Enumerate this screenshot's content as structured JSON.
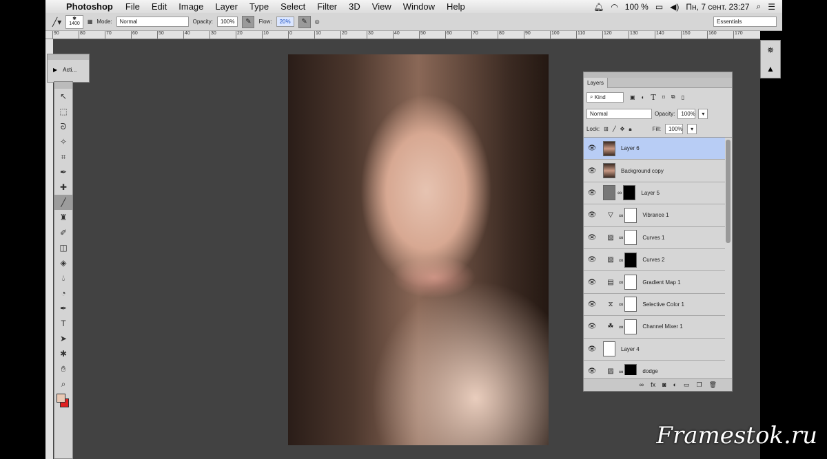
{
  "menubar": {
    "apple_icon": "apple-icon",
    "app": "Photoshop",
    "items": [
      "File",
      "Edit",
      "Image",
      "Layer",
      "Type",
      "Select",
      "Filter",
      "3D",
      "View",
      "Window",
      "Help"
    ],
    "battery": "100 %",
    "datetime": "Пн, 7 сент. 23:27"
  },
  "options": {
    "brush_size": "1400",
    "mode_label": "Mode:",
    "mode": "Normal",
    "opacity_label": "Opacity:",
    "opacity": "100%",
    "flow_label": "Flow:",
    "flow": "20%",
    "workspace": "Essentials"
  },
  "ruler": [
    "90",
    "80",
    "70",
    "60",
    "50",
    "40",
    "30",
    "20",
    "10",
    "0",
    "10",
    "20",
    "30",
    "40",
    "50",
    "60",
    "70",
    "80",
    "90",
    "100",
    "110",
    "120",
    "130",
    "140",
    "150",
    "160",
    "170"
  ],
  "actions_panel": {
    "label": "Acti..."
  },
  "layers_panel": {
    "tab": "Layers",
    "filter": "Kind",
    "blend": "Normal",
    "opacity_label": "Opacity:",
    "opacity": "100%",
    "lock_label": "Lock:",
    "fill_label": "Fill:",
    "fill": "100%",
    "layers": [
      {
        "name": "Layer 6",
        "selected": true,
        "thumb": "photo"
      },
      {
        "name": "Background copy",
        "thumb": "photo"
      },
      {
        "name": "Layer 5",
        "thumb": "gray",
        "mask": "black"
      },
      {
        "name": "Vibrance 1",
        "icon": "▽",
        "mask": "white"
      },
      {
        "name": "Curves 1",
        "icon": "▨",
        "mask": "white"
      },
      {
        "name": "Curves 2",
        "icon": "▨",
        "mask": "black"
      },
      {
        "name": "Gradient Map 1",
        "icon": "▤",
        "mask": "white"
      },
      {
        "name": "Selective Color 1",
        "icon": "⧖",
        "mask": "white"
      },
      {
        "name": "Channel Mixer 1",
        "icon": "☘",
        "mask": "white"
      },
      {
        "name": "Layer 4",
        "thumb": "white"
      },
      {
        "name": "dodge",
        "icon": "▨",
        "mask": "black"
      }
    ]
  },
  "watermark": "Framestok.ru",
  "colors": {
    "selection": "#b8cdf5",
    "canvas_bg": "#424242",
    "foreground": "#e8c8b4",
    "background": "#e02020"
  }
}
